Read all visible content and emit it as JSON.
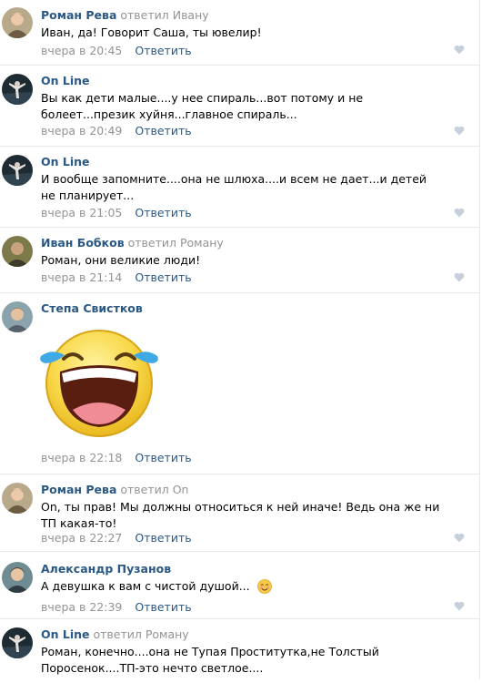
{
  "comments": [
    {
      "author": "Роман Рева",
      "reply": "ответил Ивану",
      "text": "Иван, да! Говорит Саша, ты ювелир!",
      "time": "вчера в 20:45",
      "answer": "Ответить"
    },
    {
      "author": "On Line",
      "reply": "",
      "text": "Вы как дети малые....у нее спираль...вот потому и не болеет...презик хуйня...главное спираль...",
      "time": "вчера в 20:49",
      "answer": "Ответить"
    },
    {
      "author": "On Line",
      "reply": "",
      "text": "И вообще запомните....она не шлюха....и всем не дает...и детей не планирует...",
      "time": "вчера в 21:05",
      "answer": "Ответить"
    },
    {
      "author": "Иван Бобков",
      "reply": "ответил Роману",
      "text": "Роман, они великие люди!",
      "time": "вчера в 21:14",
      "answer": "Ответить"
    },
    {
      "author": "Степа Свистков",
      "reply": "",
      "text": "",
      "time": "вчера в 22:18",
      "answer": "Ответить"
    },
    {
      "author": "Роман Рева",
      "reply": "ответил On",
      "text": "On, ты прав! Мы должны относиться к ней иначе! Ведь она же ни ТП какая-то!",
      "time": "вчера в 22:27",
      "answer": "Ответить"
    },
    {
      "author": "Александр Пузанов",
      "reply": "",
      "text": "А девушка к вам с чистой душой...",
      "time": "вчера в 22:39",
      "answer": "Ответить"
    },
    {
      "author": "On Line",
      "reply": "ответил Роману",
      "text": "Роман, конечно....она не Тупая Проститутка,не Толстый Поросенок....ТП-это нечто светлое....",
      "time": "",
      "answer": ""
    }
  ],
  "icons": {
    "heart": "heart-icon",
    "sticker": "laughing-crying-sticker",
    "emoji": "smiling-face-emoji"
  },
  "colors": {
    "link": "#2a5885",
    "muted": "#939393",
    "divider": "#e7e8ec",
    "heart": "#c5d0db"
  }
}
